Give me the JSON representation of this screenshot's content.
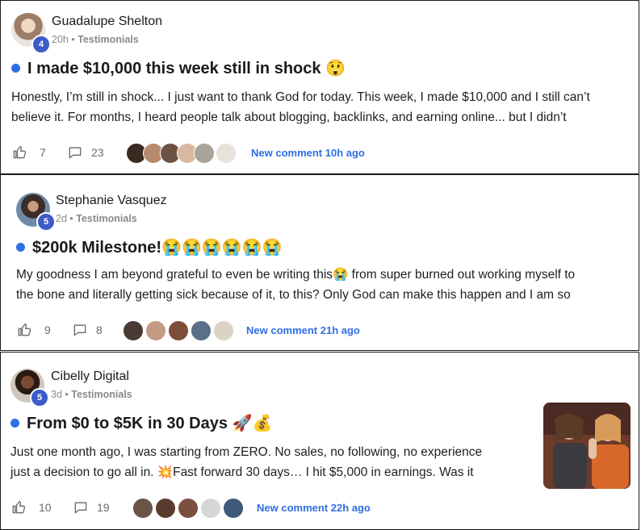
{
  "posts": [
    {
      "author": "Guadalupe Shelton",
      "level": "4",
      "time": "20h",
      "category": "Testimonials",
      "title": "I made $10,000 this week still in shock 😲",
      "lines": [
        "Honestly, I’m still in shock... I just want to thank God for today. This week, I made $10,000 and I still can’t",
        "believe it. For months, I heard people talk about blogging, backlinks, and earning online... but I didn’t"
      ],
      "likes": "7",
      "comments": "23",
      "new_comment": "New comment 10h ago"
    },
    {
      "author": "Stephanie Vasquez",
      "level": "5",
      "time": "2d",
      "category": "Testimonials",
      "title": "$200k Milestone!😭😭😭😭😭😭",
      "lines": [
        "My goodness I am beyond grateful to even be writing this😭 from super burned out working myself to",
        "the bone and literally getting sick because of it, to this? Only God can make this happen and I am so"
      ],
      "likes": "9",
      "comments": "8",
      "new_comment": "New comment 21h ago"
    },
    {
      "author": "Cibelly Digital",
      "level": "5",
      "time": "3d",
      "category": "Testimonials",
      "title": "From $0 to $5K in 30 Days 🚀💰",
      "lines": [
        "Just one month ago, I was starting from ZERO. No sales, no following, no experience",
        "just a decision to go all in. 💥Fast forward 30 days… I hit $5,000 in earnings. Was it"
      ],
      "likes": "10",
      "comments": "19",
      "new_comment": "New comment 22h ago"
    }
  ],
  "separator": "•",
  "colors": {
    "accent": "#2f6fe4",
    "badge": "#3d5bc9",
    "meta": "#8a8a8a"
  }
}
